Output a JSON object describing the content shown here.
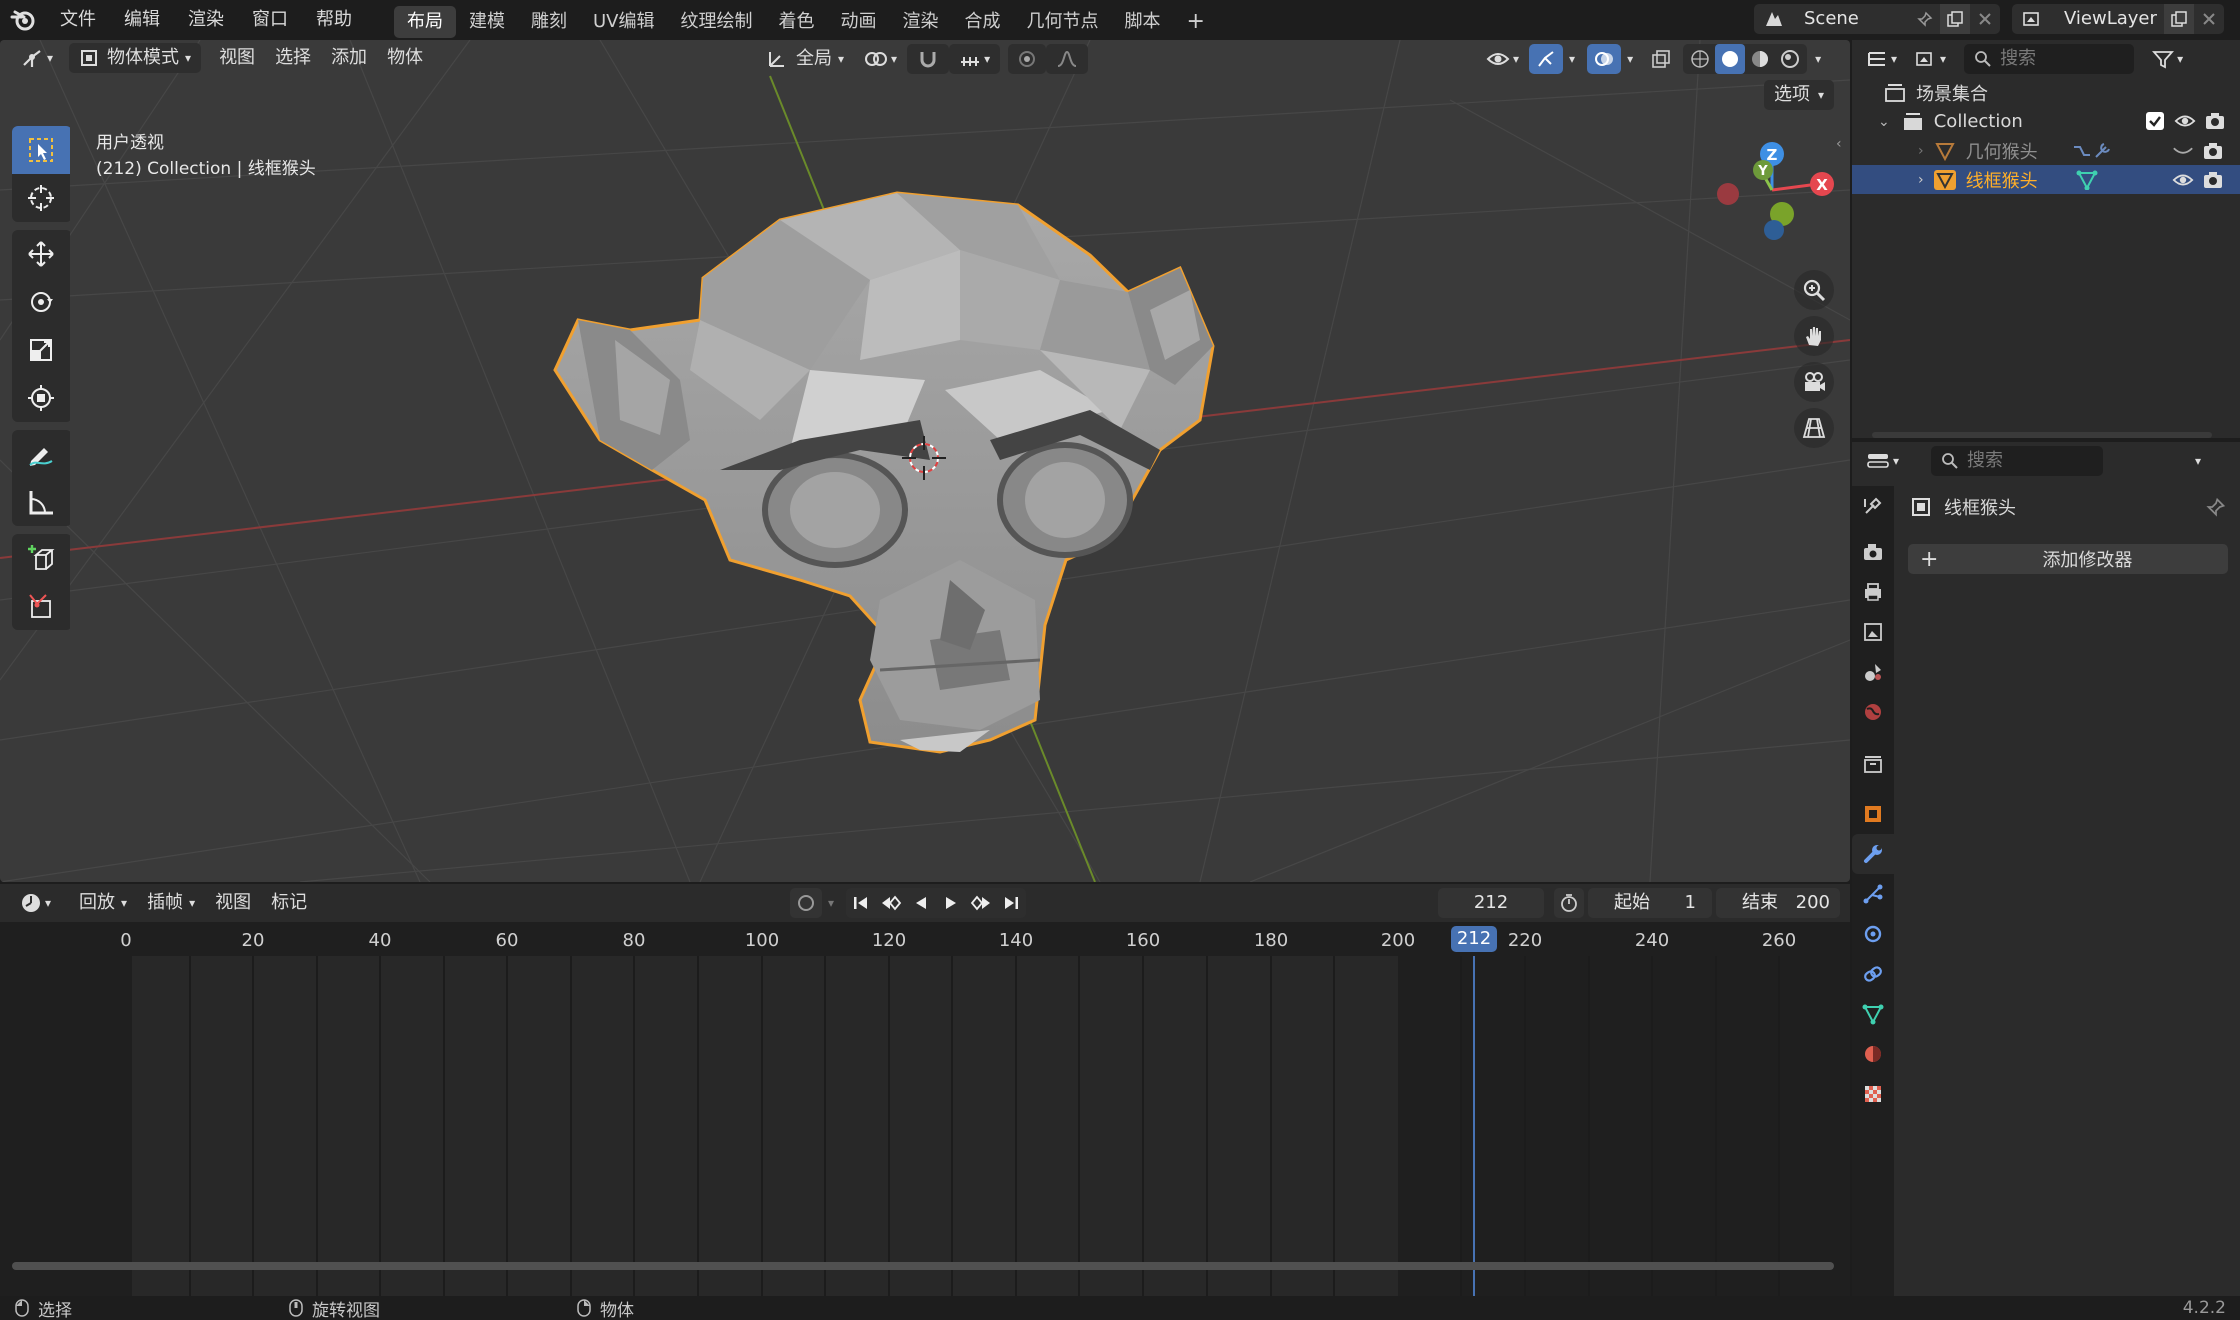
{
  "topbar": {
    "menus": [
      "文件",
      "编辑",
      "渲染",
      "窗口",
      "帮助"
    ],
    "workspaces": [
      "布局",
      "建模",
      "雕刻",
      "UV编辑",
      "纹理绘制",
      "着色",
      "动画",
      "渲染",
      "合成",
      "几何节点",
      "脚本"
    ],
    "active_workspace": "布局",
    "add_workspace": "+",
    "scene": "Scene",
    "view_layer": "ViewLayer"
  },
  "viewport": {
    "mode": "物体模式",
    "menus": [
      "视图",
      "选择",
      "添加",
      "物体"
    ],
    "transform_orientation": "全局",
    "options": "选项",
    "info_line1": "用户透视",
    "info_line2": "(212) Collection | 线框猴头",
    "gizmo_axes": {
      "x": "X",
      "y": "Y",
      "z": "Z"
    }
  },
  "timeline": {
    "playback": "回放",
    "keying": "插帧",
    "view": "视图",
    "marker": "标记",
    "current_frame": "212",
    "start_label": "起始",
    "start_value": "1",
    "end_label": "结束",
    "end_value": "200",
    "ticks": [
      "0",
      "20",
      "40",
      "60",
      "80",
      "100",
      "120",
      "140",
      "160",
      "180",
      "200",
      "220",
      "240",
      "260"
    ],
    "playhead": "212"
  },
  "outliner": {
    "search_placeholder": "搜索",
    "scene_collection": "场景集合",
    "collection": "Collection",
    "items": [
      "几何猴头",
      "线框猴头"
    ]
  },
  "properties": {
    "search_placeholder": "搜索",
    "object_name": "线框猴头",
    "add_modifier": "添加修改器",
    "add_icon": "+"
  },
  "statusbar": {
    "select": "选择",
    "rotate_view": "旋转视图",
    "object": "物体",
    "version": "4.2.2"
  },
  "colors": {
    "accent": "#4772b3",
    "selection_outline": "#f0a030",
    "active_object_text": "#ffaf29",
    "x_axis": "#e5474f",
    "y_axis": "#8bc34a",
    "z_axis": "#3e8fe4"
  }
}
